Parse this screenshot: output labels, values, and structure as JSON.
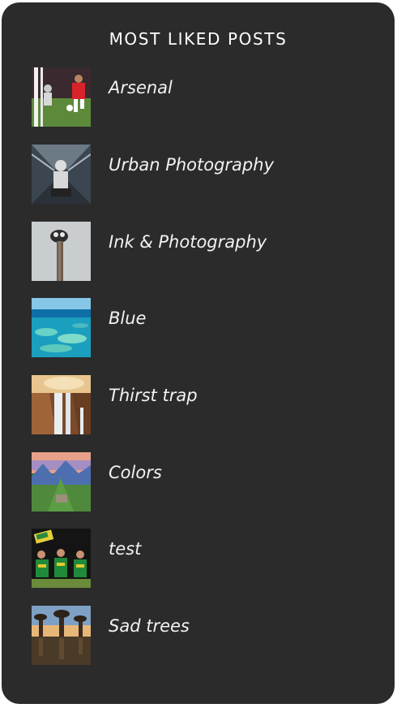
{
  "widget": {
    "title": "MOST LIKED POSTS"
  },
  "posts": [
    {
      "title": "Arsenal",
      "thumbnail": "football-match-photo"
    },
    {
      "title": "Urban Photography",
      "thumbnail": "person-in-tunnel-photo"
    },
    {
      "title": "Ink & Photography",
      "thumbnail": "ostrich-photo"
    },
    {
      "title": "Blue",
      "thumbnail": "coral-reef-photo"
    },
    {
      "title": "Thirst trap",
      "thumbnail": "waterfall-photo"
    },
    {
      "title": "Colors",
      "thumbnail": "mountain-ruins-photo"
    },
    {
      "title": "test",
      "thumbnail": "team-celebration-photo"
    },
    {
      "title": "Sad trees",
      "thumbnail": "baobab-trees-photo"
    }
  ],
  "colors": {
    "card_background": "#2b2b2b",
    "text": "#f2f2f2"
  }
}
